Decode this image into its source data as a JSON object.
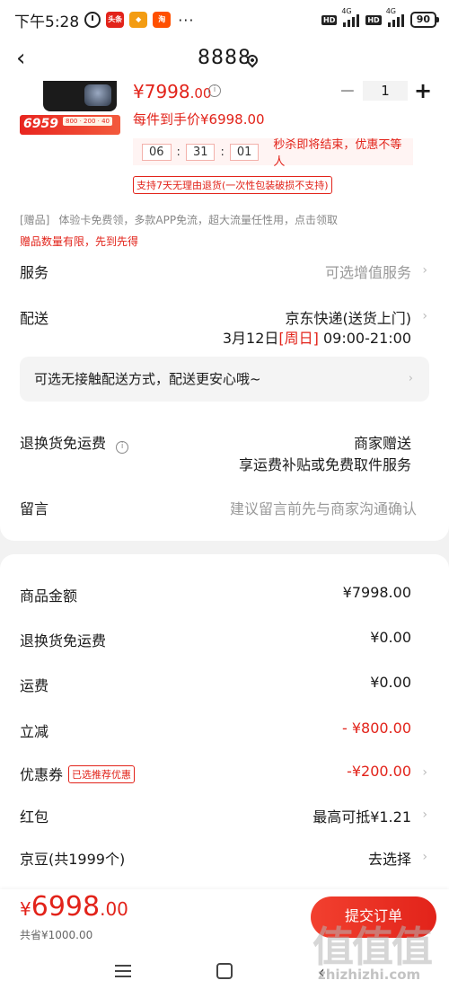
{
  "status_bar": {
    "time": "下午5:28",
    "network1": "4G",
    "network2": "4G",
    "hd": "HD",
    "battery": "90",
    "apps": [
      {
        "label": "头条",
        "color": "#e2231a"
      },
      {
        "label": "",
        "color": "#f39c12"
      },
      {
        "label": "淘",
        "color": "#ff5000"
      }
    ],
    "more": "···"
  },
  "header": {
    "title": "8888"
  },
  "product": {
    "price_int": "¥7998",
    "price_dec": ".00",
    "thumb_price": "6959",
    "thumb_coupons": "800 · 200 · 40",
    "quantity": "1",
    "hand_price": "每件到手价¥6998.00",
    "countdown": {
      "h": "06",
      "m": "31",
      "s": "01",
      "message": "秒杀即将结束，优惠不等人"
    },
    "returns_tag": "支持7天无理由退货(一次性包装破损不支持)",
    "gift_items": [
      "[赠品]",
      "体验卡免费领，多款APP免流，超大流量任性用，点击领取"
    ],
    "gift_limit": "赠品数量有限，先到先得"
  },
  "service": {
    "label": "服务",
    "value": "可选增值服务"
  },
  "delivery": {
    "label": "配送",
    "method": "京东快递(送货上门)",
    "date": "3月12日",
    "weekday": "[周日]",
    "time": "09:00-21:00"
  },
  "contactless": "可选无接触配送方式，配送更安心哦~",
  "return_shipping": {
    "label": "退换货免运费",
    "value1": "商家赠送",
    "value2": "享运费补贴或免费取件服务"
  },
  "message": {
    "label": "留言",
    "placeholder": "建议留言前先与商家沟通确认"
  },
  "summary": {
    "goods_amount": {
      "label": "商品金额",
      "value": "¥7998.00"
    },
    "return_fee": {
      "label": "退换货免运费",
      "value": "¥0.00"
    },
    "shipping": {
      "label": "运费",
      "value": "¥0.00"
    },
    "discount": {
      "label": "立减",
      "value": "- ¥800.00"
    },
    "coupon": {
      "label": "优惠券",
      "tag": "已选推荐优惠",
      "value": "-¥200.00"
    },
    "redpack": {
      "label": "红包",
      "value": "最高可抵¥1.21"
    },
    "jingdou": {
      "label": "京豆(共1999个)",
      "value": "去选择"
    }
  },
  "footer": {
    "currency": "¥",
    "total_int": "6998",
    "total_dec": ".00",
    "saved": "共省¥1000.00",
    "submit": "提交订单"
  },
  "watermark": {
    "logo": "值值值",
    "domain": "zhizhizhi.com"
  }
}
